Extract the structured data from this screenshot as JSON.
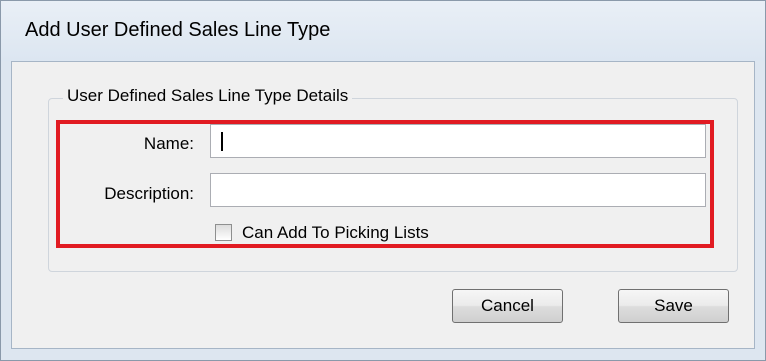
{
  "window": {
    "title": "Add User Defined Sales Line Type"
  },
  "group": {
    "legend": "User Defined Sales Line Type Details"
  },
  "form": {
    "name_label": "Name:",
    "name_value": "",
    "description_label": "Description:",
    "description_value": "",
    "picking_checkbox_label": "Can Add To Picking Lists",
    "picking_checkbox_checked": false
  },
  "buttons": {
    "cancel_label": "Cancel",
    "save_label": "Save"
  },
  "colors": {
    "highlight": "#e11b22",
    "window_frame": "#dde6f0",
    "client_bg": "#f0f0f0"
  }
}
